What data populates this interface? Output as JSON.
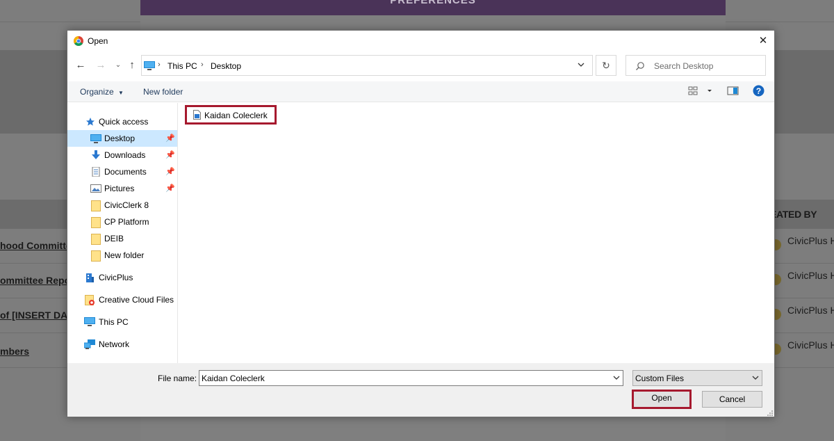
{
  "background": {
    "modal_title": "PREFERENCES",
    "created_by_header": "EATED BY",
    "rows": [
      {
        "title": "hood Committe",
        "user": "CivicPlus H"
      },
      {
        "title": "ommittee Repo",
        "user": "CivicPlus H"
      },
      {
        "title": "of [INSERT DAT",
        "user": "CivicPlus H"
      },
      {
        "title": "mbers",
        "user": "CivicPlus H"
      }
    ]
  },
  "dialog": {
    "title": "Open",
    "app_icon": "chrome-icon",
    "close_icon": "close-icon"
  },
  "address": {
    "crumbs": [
      "This PC",
      "Desktop"
    ],
    "search_placeholder": "Search Desktop"
  },
  "toolbar": {
    "organize_label": "Organize",
    "new_folder_label": "New folder"
  },
  "nav": {
    "quick_access": "Quick access",
    "items": [
      {
        "label": "Desktop",
        "icon": "desktop-icon",
        "pinned": true
      },
      {
        "label": "Downloads",
        "icon": "downloads-icon",
        "pinned": true
      },
      {
        "label": "Documents",
        "icon": "documents-icon",
        "pinned": true
      },
      {
        "label": "Pictures",
        "icon": "pictures-icon",
        "pinned": true
      },
      {
        "label": "CivicClerk 8",
        "icon": "folder-icon",
        "pinned": false
      },
      {
        "label": "CP Platform",
        "icon": "folder-icon",
        "pinned": false
      },
      {
        "label": "DEIB",
        "icon": "folder-icon",
        "pinned": false
      },
      {
        "label": "New folder",
        "icon": "folder-icon",
        "pinned": false
      }
    ],
    "civicplus": "CivicPlus",
    "creative_cloud": "Creative Cloud Files",
    "this_pc": "This PC",
    "network": "Network"
  },
  "files": [
    {
      "name": "Kaidan Coleclerk",
      "icon": "file-icon"
    }
  ],
  "bottom": {
    "file_name_label": "File name:",
    "file_name_value": "Kaidan Coleclerk",
    "file_type_value": "Custom Files",
    "open_label": "Open",
    "cancel_label": "Cancel"
  },
  "colors": {
    "highlight": "#a6192e",
    "selection": "#cce8ff",
    "toolbar_text": "#1e395b"
  }
}
